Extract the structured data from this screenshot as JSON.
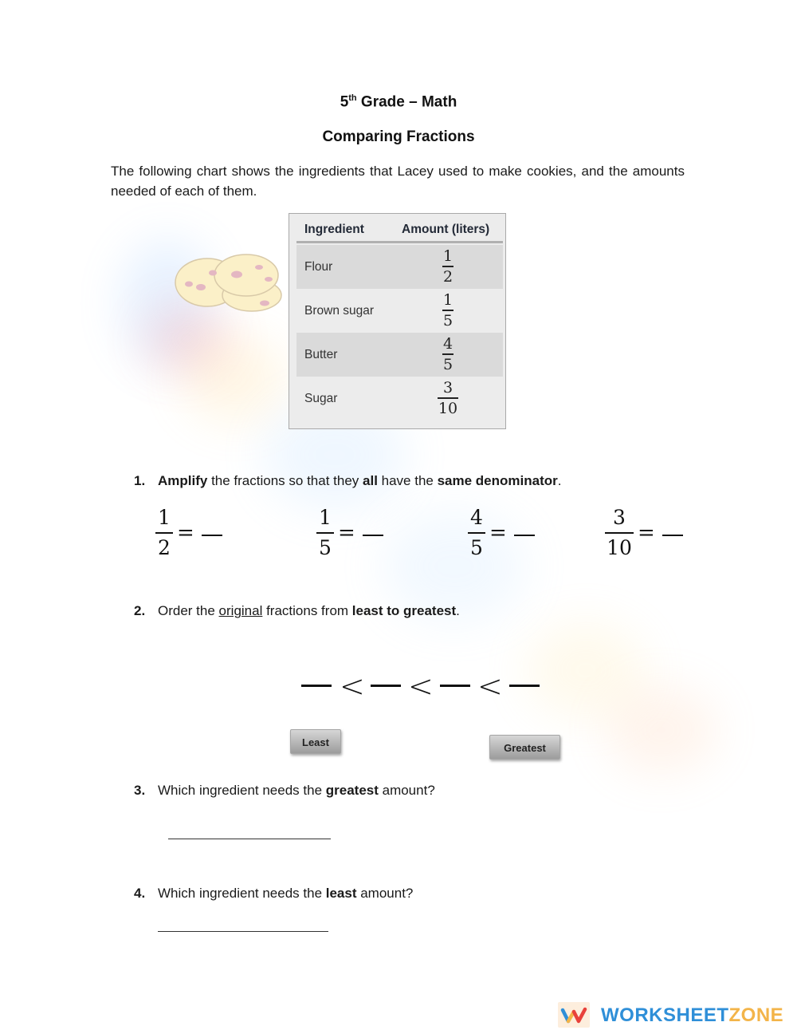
{
  "header": {
    "grade_number": "5",
    "grade_suffix": "th",
    "grade_rest": " Grade – Math",
    "subtitle": "Comparing Fractions"
  },
  "intro": "The following chart shows the ingredients that Lacey used to make cookies, and the amounts needed of each of them.",
  "illustration": "cookies-icon",
  "table": {
    "headers": [
      "Ingredient",
      "Amount (liters)"
    ],
    "rows": [
      {
        "ingredient": "Flour",
        "numerator": "1",
        "denominator": "2"
      },
      {
        "ingredient": "Brown sugar",
        "numerator": "1",
        "denominator": "5"
      },
      {
        "ingredient": "Butter",
        "numerator": "4",
        "denominator": "5"
      },
      {
        "ingredient": "Sugar",
        "numerator": "3",
        "denominator": "10"
      }
    ]
  },
  "questions": {
    "q1": {
      "number": "1.",
      "parts": [
        "Amplify",
        " the fractions so that they ",
        "all",
        " have the ",
        "same denominator",
        "."
      ],
      "fractions": [
        {
          "numerator": "1",
          "denominator": "2"
        },
        {
          "numerator": "1",
          "denominator": "5"
        },
        {
          "numerator": "4",
          "denominator": "5"
        },
        {
          "numerator": "3",
          "denominator": "10"
        }
      ],
      "equals": "="
    },
    "q2": {
      "number": "2.",
      "parts": [
        "Order the ",
        "original",
        " fractions from ",
        "least to greatest",
        "."
      ],
      "comparator": "<",
      "least_label": "Least",
      "greatest_label": "Greatest"
    },
    "q3": {
      "number": "3.",
      "parts": [
        "Which ingredient needs the ",
        "greatest",
        " amount?"
      ]
    },
    "q4": {
      "number": "4.",
      "parts": [
        "Which ingredient needs the ",
        "least",
        " amount?"
      ]
    }
  },
  "footer": {
    "logo_part1": "WORKSHEET",
    "logo_part2": "ZONE",
    "colors": {
      "blue": "#2f8fd8",
      "orange": "#f3b449",
      "red": "#e8413b"
    }
  }
}
